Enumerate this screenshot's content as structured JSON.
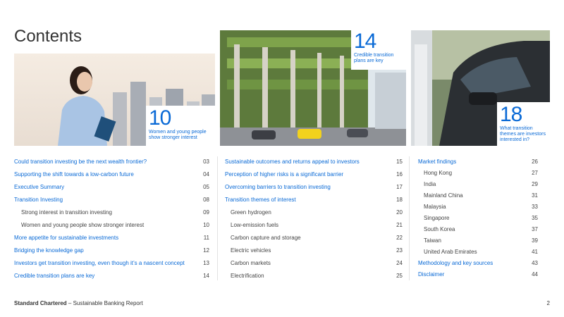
{
  "page_title": "Contents",
  "callouts": [
    {
      "number": "10",
      "caption": "Women and young people show stronger interest"
    },
    {
      "number": "14",
      "caption": "Credible transition plans are key"
    },
    {
      "number": "18",
      "caption": "What transition themes are investors interested in?"
    }
  ],
  "col1": [
    {
      "label": "Could transition investing be the next wealth frontier?",
      "page": "03"
    },
    {
      "label": "Supporting the shift towards a low-carbon future",
      "page": "04"
    },
    {
      "label": "Executive Summary",
      "page": "05"
    },
    {
      "label": "Transition Investing",
      "page": "08"
    },
    {
      "label": "Strong interest in transition investing",
      "page": "09"
    },
    {
      "label": "Women and young people show stronger interest",
      "page": "10"
    },
    {
      "label": "More appetite for sustainable investments",
      "page": "11"
    },
    {
      "label": "Bridging the knowledge gap",
      "page": "12"
    },
    {
      "label": "Investors get transition investing, even though it’s a nascent concept",
      "page": "13"
    },
    {
      "label": "Credible transition plans are key",
      "page": "14"
    }
  ],
  "col2": [
    {
      "label": "Sustainable outcomes and returns appeal to investors",
      "page": "15"
    },
    {
      "label": "Perception of higher risks is a significant barrier",
      "page": "16"
    },
    {
      "label": "Overcoming barriers to transition investing",
      "page": "17"
    },
    {
      "label": "Transition themes of interest",
      "page": "18"
    },
    {
      "label": "Green hydrogen",
      "page": "20"
    },
    {
      "label": "Low-emission fuels",
      "page": "21"
    },
    {
      "label": "Carbon capture and storage",
      "page": "22"
    },
    {
      "label": "Electric vehicles",
      "page": "23"
    },
    {
      "label": "Carbon markets",
      "page": "24"
    },
    {
      "label": "Electrification",
      "page": "25"
    }
  ],
  "col3": [
    {
      "label": "Market findings",
      "page": "26"
    },
    {
      "label": "Hong Kong",
      "page": "27"
    },
    {
      "label": "India",
      "page": "29"
    },
    {
      "label": "Mainland China",
      "page": "31"
    },
    {
      "label": "Malaysia",
      "page": "33"
    },
    {
      "label": "Singapore",
      "page": "35"
    },
    {
      "label": "South Korea",
      "page": "37"
    },
    {
      "label": "Taiwan",
      "page": "39"
    },
    {
      "label": "United Arab Emirates",
      "page": "41"
    },
    {
      "label": "Methodology and key sources",
      "page": "43"
    },
    {
      "label": "Disclaimer",
      "page": "44"
    }
  ],
  "footer": {
    "brand": "Standard Chartered",
    "separator": " – ",
    "report": "Sustainable Banking Report",
    "page": "2"
  },
  "colors": {
    "accent": "#0a6ad6",
    "text": "#333333"
  }
}
